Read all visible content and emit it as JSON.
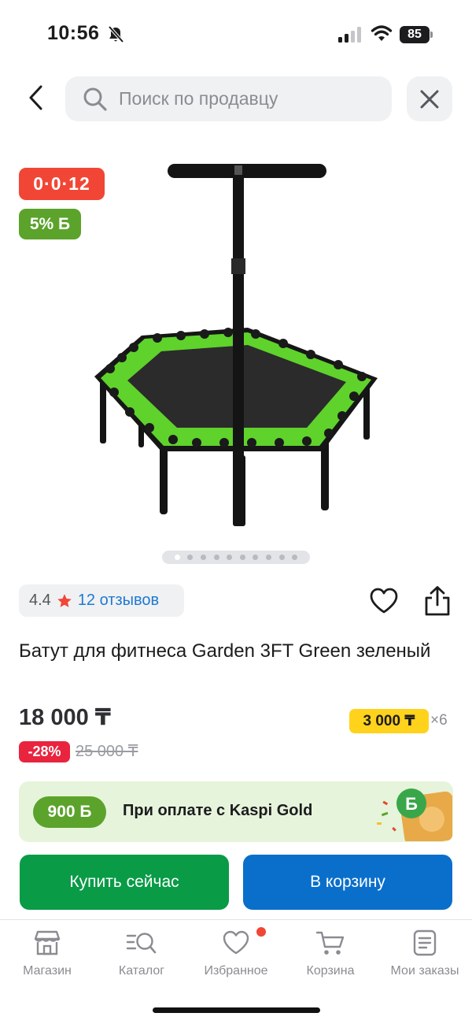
{
  "status_bar": {
    "time": "10:56",
    "battery": "85"
  },
  "search": {
    "placeholder": "Поиск по продавцу"
  },
  "icons": {
    "bell": "bell-slash-icon",
    "signal": "cellular-signal-icon",
    "wifi": "wifi-icon",
    "back": "chevron-left-icon",
    "search": "search-icon",
    "close": "close-icon",
    "star": "star-icon",
    "heart": "heart-icon",
    "share": "share-icon"
  },
  "product": {
    "installment_badge": "0·0·12",
    "bonus_badge": "5% Б",
    "image_dots_count": 10,
    "image_active_index": 0,
    "rating": "4.4",
    "reviews": "12 отзывов",
    "title": "Батут для фитнеса Garden 3FT Green зеленый",
    "price": "18 000 ₸",
    "installment_price": "3 000 ₸",
    "installment_months": "×6",
    "discount": "-28%",
    "old_price": "25 000 ₸"
  },
  "gold_banner": {
    "bonus": "900 Б",
    "text": "При оплате с Kaspi Gold"
  },
  "actions": {
    "buy_now": "Купить сейчас",
    "add_to_cart": "В корзину"
  },
  "tab_bar": {
    "items": [
      {
        "label": "Магазин",
        "icon": "store-icon"
      },
      {
        "label": "Каталог",
        "icon": "catalog-search-icon"
      },
      {
        "label": "Избранное",
        "icon": "heart-icon",
        "has_notification": true
      },
      {
        "label": "Корзина",
        "icon": "cart-icon"
      },
      {
        "label": "Мои заказы",
        "icon": "orders-icon"
      }
    ]
  },
  "colors": {
    "installment_red": "#f14635",
    "bonus_green": "#5ba32b",
    "installment_yellow": "#ffd21c",
    "discount_red": "#e9243f",
    "buy_green": "#0a9b47",
    "cart_blue": "#0a6fcb",
    "link_blue": "#1f79d1",
    "gold_banner_bg": "#e6f4db",
    "trampoline_accent": "#5fd22c"
  }
}
